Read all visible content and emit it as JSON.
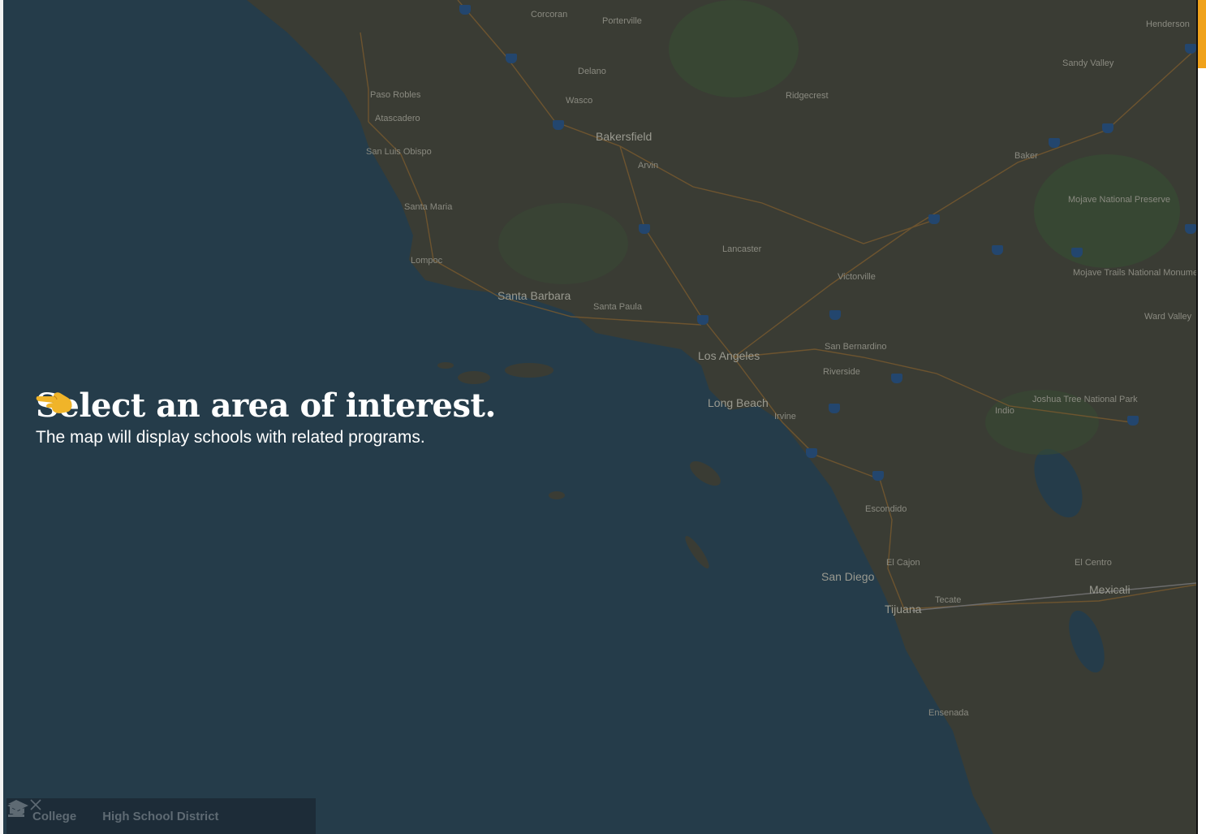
{
  "prompt": {
    "title": "Select an area of interest.",
    "subtitle": "The map will display schools with related programs.",
    "pointer_icon": "pointing-hand-icon"
  },
  "map": {
    "water_color": "#253c4a",
    "land_color": "#3a3c34",
    "places": [
      {
        "name": "Corcoran"
      },
      {
        "name": "Porterville"
      },
      {
        "name": "Delano"
      },
      {
        "name": "Paso Robles"
      },
      {
        "name": "Wasco"
      },
      {
        "name": "Atascadero"
      },
      {
        "name": "Bakersfield"
      },
      {
        "name": "San Luis Obispo"
      },
      {
        "name": "Arvin"
      },
      {
        "name": "Ridgecrest"
      },
      {
        "name": "Santa Maria"
      },
      {
        "name": "Lompoc"
      },
      {
        "name": "Lancaster"
      },
      {
        "name": "Victorville"
      },
      {
        "name": "Santa Barbara"
      },
      {
        "name": "Santa Paula"
      },
      {
        "name": "Los Angeles"
      },
      {
        "name": "San Bernardino"
      },
      {
        "name": "Riverside"
      },
      {
        "name": "Long Beach"
      },
      {
        "name": "Irvine"
      },
      {
        "name": "Indio"
      },
      {
        "name": "Escondido"
      },
      {
        "name": "El Cajon"
      },
      {
        "name": "San Diego"
      },
      {
        "name": "Tijuana"
      },
      {
        "name": "Tecate"
      },
      {
        "name": "Mexicali"
      },
      {
        "name": "El Centro"
      },
      {
        "name": "Ensenada"
      },
      {
        "name": "Henderson"
      },
      {
        "name": "Sandy Valley"
      },
      {
        "name": "Baker"
      },
      {
        "name": "Mojave National Preserve"
      },
      {
        "name": "Mojave Trails National Monument"
      },
      {
        "name": "Ward Valley"
      },
      {
        "name": "Joshua Tree National Park"
      }
    ]
  },
  "legend": {
    "college_label": "College",
    "college_icon": "college-building-icon",
    "district_label": "High School District",
    "district_icon": "graduation-cap-icon",
    "close_icon": "close-icon"
  },
  "colors": {
    "accent": "#f0a21b",
    "legend_bg": "#1d2c38",
    "legend_text": "#5e6a73"
  }
}
